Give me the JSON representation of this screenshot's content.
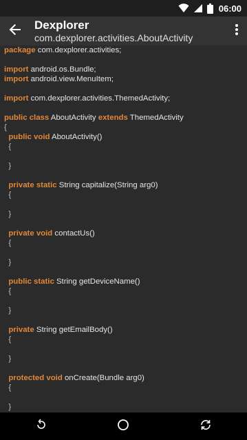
{
  "status": {
    "clock": "06:00",
    "icons": [
      "wifi-icon",
      "signal-icon",
      "battery-icon"
    ]
  },
  "toolbar": {
    "title": "Dexplorer",
    "subtitle": "com.dexplorer.activities.AboutActivity",
    "back_icon": "arrow-back-icon",
    "overflow_icon": "more-vert-icon"
  },
  "code": {
    "lines": [
      {
        "kw": "package",
        "text": " com.dexplorer.activities;"
      },
      {
        "kw": "",
        "text": ""
      },
      {
        "kw": "import",
        "text": " android.os.Bundle;"
      },
      {
        "kw": "import",
        "text": " android.view.MenuItem;"
      },
      {
        "kw": "",
        "text": ""
      },
      {
        "kw": "import",
        "text": " com.dexplorer.activities.ThemedActivity;"
      },
      {
        "kw": "",
        "text": ""
      },
      {
        "kw": "public class",
        "text": " AboutActivity ",
        "kw2": "extends",
        "text2": " ThemedActivity"
      },
      {
        "kw": "",
        "text": "{"
      },
      {
        "kw": "  public void",
        "text": " AboutActivity()"
      },
      {
        "kw": "",
        "text": "  {"
      },
      {
        "kw": "",
        "text": ""
      },
      {
        "kw": "",
        "text": "  }"
      },
      {
        "kw": "",
        "text": ""
      },
      {
        "kw": "  private static",
        "text": " String capitalize(String arg0)"
      },
      {
        "kw": "",
        "text": "  {"
      },
      {
        "kw": "",
        "text": ""
      },
      {
        "kw": "",
        "text": "  }"
      },
      {
        "kw": "",
        "text": ""
      },
      {
        "kw": "  private void",
        "text": " contactUs()"
      },
      {
        "kw": "",
        "text": "  {"
      },
      {
        "kw": "",
        "text": ""
      },
      {
        "kw": "",
        "text": "  }"
      },
      {
        "kw": "",
        "text": ""
      },
      {
        "kw": "  public static",
        "text": " String getDeviceName()"
      },
      {
        "kw": "",
        "text": "  {"
      },
      {
        "kw": "",
        "text": ""
      },
      {
        "kw": "",
        "text": "  }"
      },
      {
        "kw": "",
        "text": ""
      },
      {
        "kw": "  private",
        "text": " String getEmailBody()"
      },
      {
        "kw": "",
        "text": "  {"
      },
      {
        "kw": "",
        "text": ""
      },
      {
        "kw": "",
        "text": "  }"
      },
      {
        "kw": "",
        "text": ""
      },
      {
        "kw": "  protected void",
        "text": " onCreate(Bundle arg0)"
      },
      {
        "kw": "",
        "text": "  {"
      },
      {
        "kw": "",
        "text": ""
      },
      {
        "kw": "",
        "text": "  }"
      }
    ]
  },
  "navigation": {
    "back_icon": "nav-back-icon",
    "home_icon": "nav-home-icon",
    "recents_icon": "nav-rotate-icon"
  },
  "colors": {
    "keyword": "#e0883a",
    "text": "#e6e6e6",
    "background": "#2b2b2b",
    "toolbar": "#333333"
  }
}
